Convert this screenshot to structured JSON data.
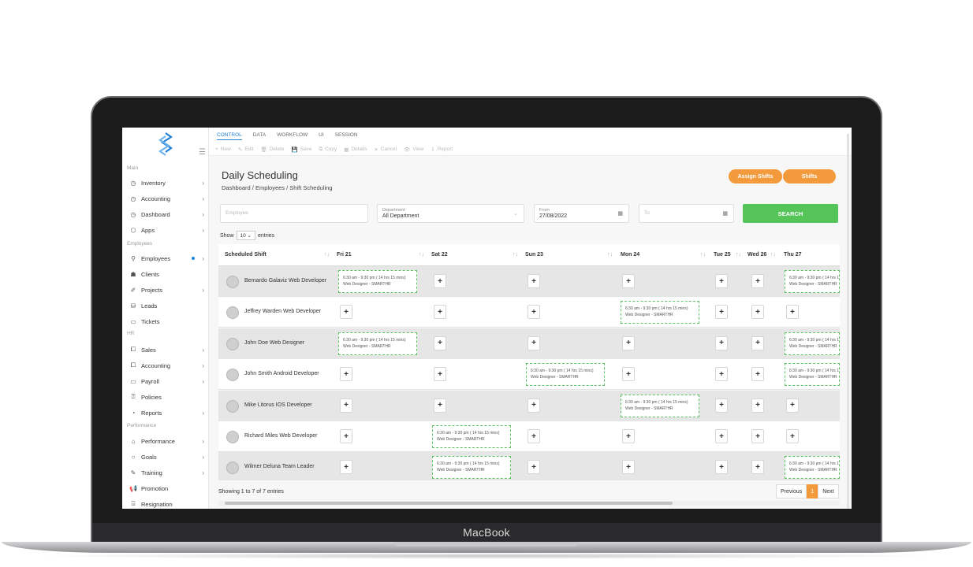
{
  "device": {
    "brand": "MacBook"
  },
  "topbar": {
    "tabs": [
      "CONTROL",
      "DATA",
      "WORKFLOW",
      "UI",
      "SESSION"
    ],
    "tools": [
      {
        "icon": "+",
        "label": "New"
      },
      {
        "icon": "✎",
        "label": "Edit"
      },
      {
        "icon": "🗑",
        "label": "Delete"
      },
      {
        "icon": "💾",
        "label": "Save"
      },
      {
        "icon": "⧉",
        "label": "Copy"
      },
      {
        "icon": "▦",
        "label": "Details"
      },
      {
        "icon": "✕",
        "label": "Cancel"
      },
      {
        "icon": "👁",
        "label": "View"
      },
      {
        "icon": "⇩",
        "label": "Report"
      }
    ]
  },
  "sidebar": {
    "sections": [
      {
        "title": "Main",
        "items": [
          {
            "label": "Inventory",
            "icon": "◷",
            "chevron": true
          },
          {
            "label": "Accounting",
            "icon": "◷",
            "chevron": true
          },
          {
            "label": "Dashboard",
            "icon": "◷",
            "chevron": true
          },
          {
            "label": "Apps",
            "icon": "⬡",
            "chevron": true
          }
        ]
      },
      {
        "title": "Employees",
        "items": [
          {
            "label": "Employees",
            "icon": "⚲",
            "chevron": true,
            "dot": true
          },
          {
            "label": "Clients",
            "icon": "☗",
            "chevron": false
          },
          {
            "label": "Projects",
            "icon": "✐",
            "chevron": true
          },
          {
            "label": "Leads",
            "icon": "⛁",
            "chevron": false
          },
          {
            "label": "Tickets",
            "icon": "▭",
            "chevron": false
          }
        ]
      },
      {
        "title": "HR",
        "items": [
          {
            "label": "Sales",
            "icon": "⧠",
            "chevron": true
          },
          {
            "label": "Accounting",
            "icon": "⧠",
            "chevron": true
          },
          {
            "label": "Payroll",
            "icon": "▭",
            "chevron": true
          },
          {
            "label": "Policies",
            "icon": "⍰",
            "chevron": false
          },
          {
            "label": "Reports",
            "icon": "◔",
            "chevron": true
          }
        ]
      },
      {
        "title": "Performance",
        "items": [
          {
            "label": "Performance",
            "icon": "⌂",
            "chevron": true
          },
          {
            "label": "Goals",
            "icon": "○",
            "chevron": true
          },
          {
            "label": "Training",
            "icon": "✎",
            "chevron": true
          },
          {
            "label": "Promotion",
            "icon": "📢",
            "chevron": false
          },
          {
            "label": "Resignation",
            "icon": "⍈",
            "chevron": false
          }
        ]
      }
    ]
  },
  "page": {
    "title": "Daily Scheduling",
    "breadcrumb": "Dashboard  /  Employees  /  Shift Scheduling",
    "assign_button": "Assign Shifts",
    "shifts_button": "Shifts"
  },
  "filters": {
    "employee_placeholder": "Employee",
    "department_label": "Department",
    "department_value": "All Department",
    "from_label": "From",
    "from_value": "27/08/2022",
    "to_placeholder": "To",
    "search_label": "SEARCH"
  },
  "entries": {
    "show": "Show",
    "count": "10",
    "suffix": "entries"
  },
  "table": {
    "headers": [
      "Scheduled Shift",
      "Fri 21",
      "Sat 22",
      "Sun 23",
      "Mon 24",
      "Tue 25",
      "Wed 26",
      "Thu 27"
    ],
    "shift_line1": "6:30 am - 9:30 pm ( 14 hrs 15 mins)",
    "shift_line2": "Web Designer - SMARTHR",
    "rows": [
      {
        "name": "Bernardo Galaviz Web Developer",
        "cells": [
          "shift",
          "add",
          "add",
          "add",
          "add",
          "add",
          "shift"
        ]
      },
      {
        "name": "Jeffrey Warden Web Developer",
        "cells": [
          "add",
          "add",
          "add",
          "shift",
          "add",
          "add",
          "add"
        ]
      },
      {
        "name": "John Doe Web Designer",
        "cells": [
          "shift",
          "add",
          "add",
          "add",
          "add",
          "add",
          "shift"
        ]
      },
      {
        "name": "John Smith Android Developer",
        "cells": [
          "add",
          "add",
          "shift",
          "add",
          "add",
          "add",
          "shift"
        ]
      },
      {
        "name": "Mike Litorus IOS Developer",
        "cells": [
          "add",
          "add",
          "add",
          "shift",
          "add",
          "add",
          "add"
        ]
      },
      {
        "name": "Richard Miles Web Developer",
        "cells": [
          "add",
          "shift",
          "add",
          "add",
          "add",
          "add",
          "add"
        ]
      },
      {
        "name": "Wilmer Deluna Team Leader",
        "cells": [
          "add",
          "shift",
          "add",
          "add",
          "add",
          "add",
          "shift"
        ]
      }
    ]
  },
  "footer": {
    "info": "Showing 1 to 7 of 7 entries",
    "previous": "Previous",
    "page": "1",
    "next": "Next"
  },
  "colors": {
    "accent": "#f39a3c",
    "primary": "#1f7fd6",
    "success": "#55c55a"
  }
}
